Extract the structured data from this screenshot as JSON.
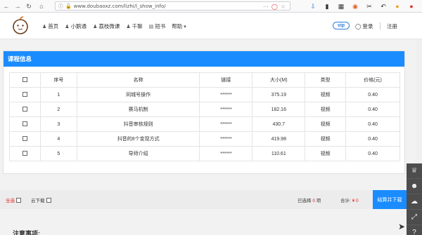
{
  "browser": {
    "url": "www.doubaoxz.com/lizhi/l_show_info/",
    "back_icon": "back-arrow-icon",
    "forward_icon": "forward-arrow-icon",
    "reload_icon": "reload-icon",
    "home_icon": "home-icon"
  },
  "header": {
    "menu": [
      {
        "label": "首页",
        "icon": "home-icon"
      },
      {
        "label": "小鹅通",
        "icon": "user-icon"
      },
      {
        "label": "荔枝微课",
        "icon": "user-icon"
      },
      {
        "label": "千聊",
        "icon": "user-icon"
      },
      {
        "label": "短书",
        "icon": "book-icon"
      },
      {
        "label": "帮助",
        "icon": "caret-down-icon"
      }
    ],
    "vip": "vip",
    "login": "登录",
    "register": "注册"
  },
  "panel": {
    "title": "课程信息",
    "columns": [
      "序号",
      "名称",
      "链接",
      "大小(M)",
      "类型",
      "价格(元)"
    ],
    "rows": [
      {
        "index": "1",
        "name": "同城号操作",
        "link": "******",
        "size": "375.19",
        "type": "视频",
        "price": "0.40"
      },
      {
        "index": "2",
        "name": "赛马机制",
        "link": "******",
        "size": "182.16",
        "type": "视频",
        "price": "0.40"
      },
      {
        "index": "3",
        "name": "抖音审核规则",
        "link": "******",
        "size": "430.7",
        "type": "视频",
        "price": "0.40"
      },
      {
        "index": "4",
        "name": "抖音的8个变现方式",
        "link": "******",
        "size": "419.98",
        "type": "视频",
        "price": "0.40"
      },
      {
        "index": "5",
        "name": "导师介绍",
        "link": "******",
        "size": "110.61",
        "type": "视频",
        "price": "0.40"
      }
    ]
  },
  "bottom": {
    "select_all": "全选",
    "cloud_download": "云下载",
    "selected_prefix": "已选择",
    "selected_count": "0",
    "selected_suffix": "项",
    "total_label": "合计:",
    "total_amount": "¥ 0",
    "checkout": "结算并下载"
  },
  "notes_title": "注意事项:",
  "accent": "#1a8cff"
}
